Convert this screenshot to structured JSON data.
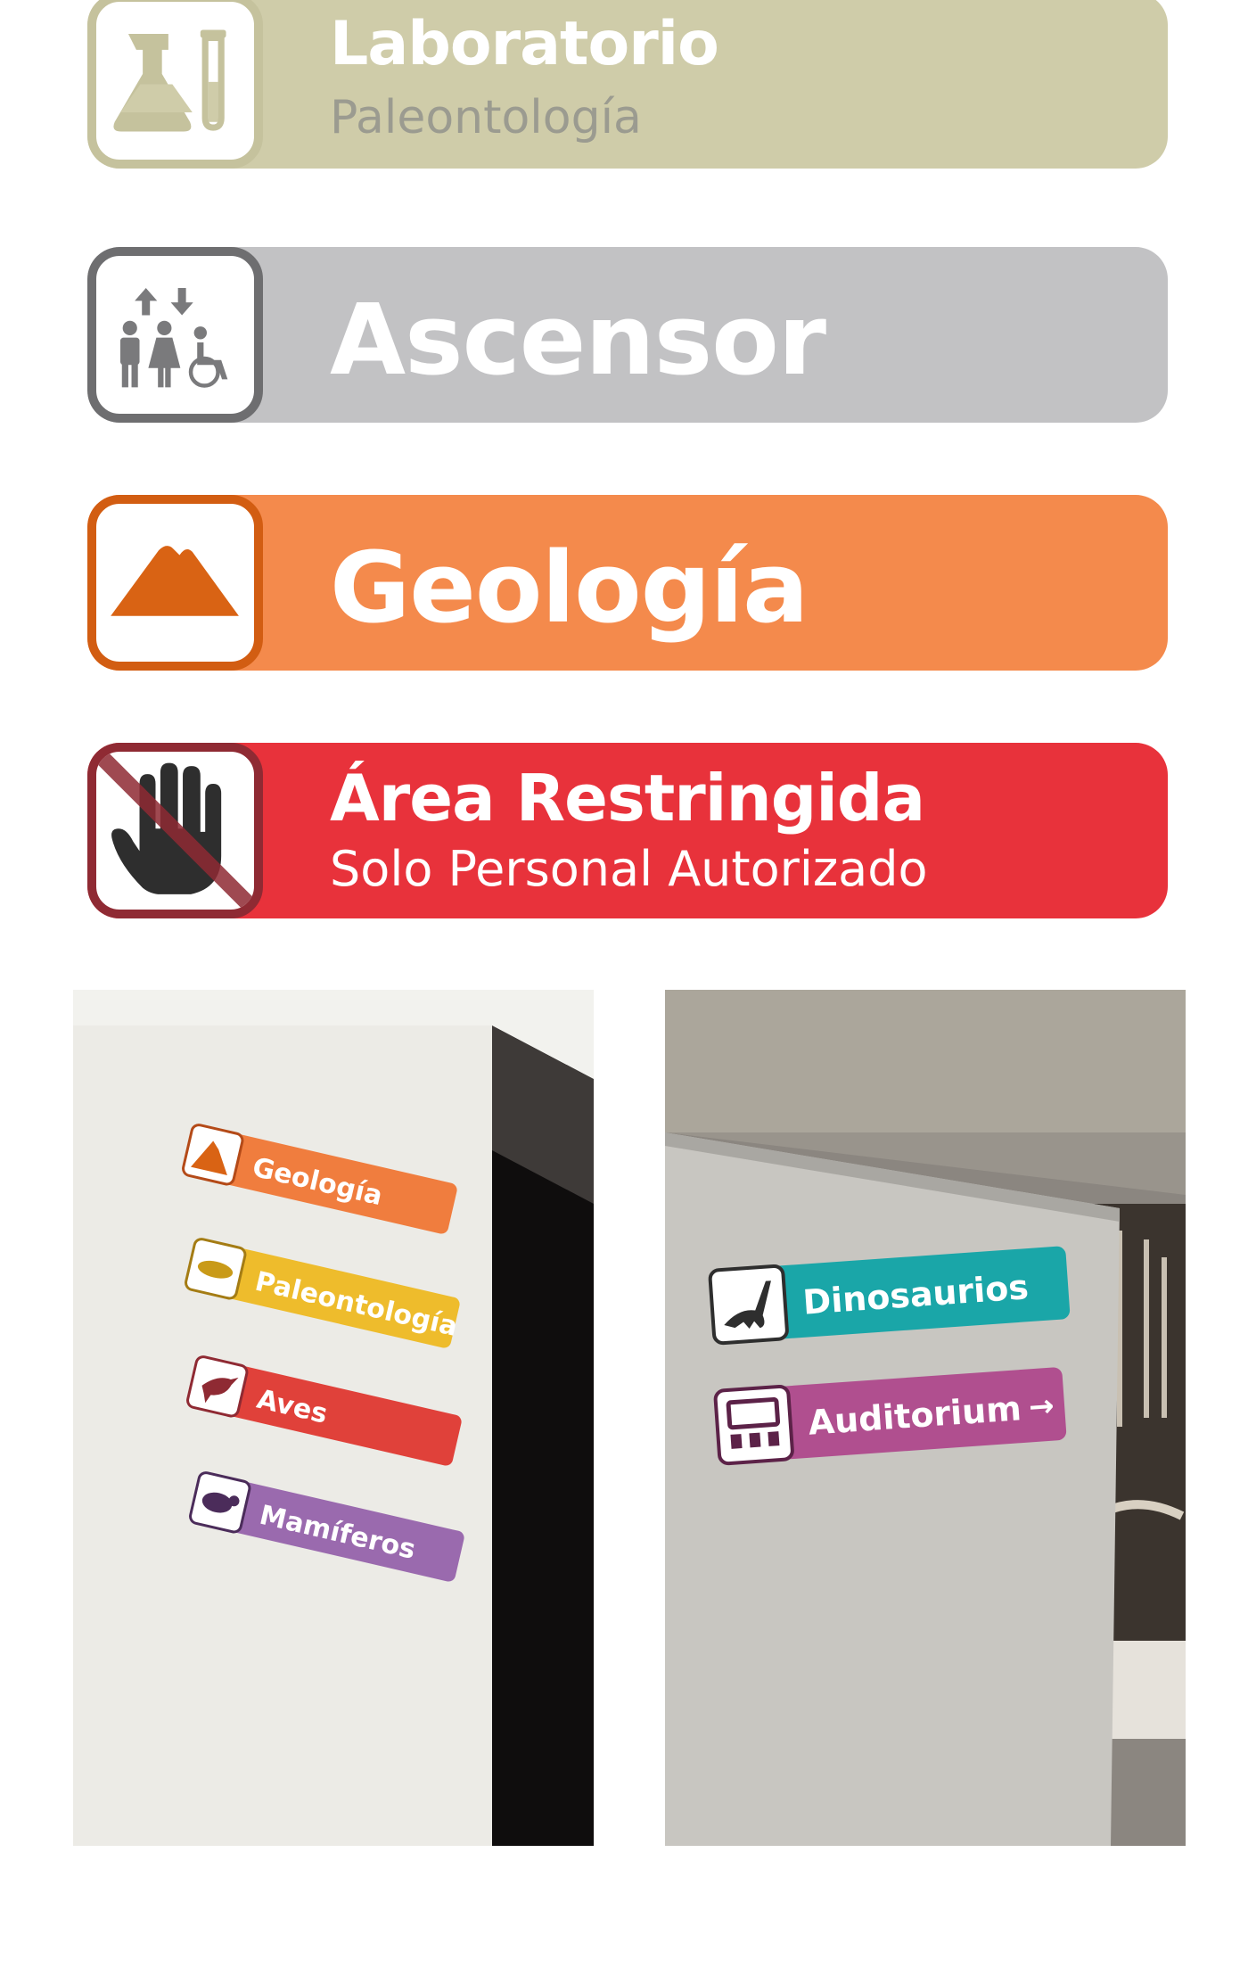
{
  "signs": [
    {
      "title": "Laboratorio",
      "subtitle": "Paleontología",
      "icon": "lab-flask-icon",
      "color": "#cfcca9"
    },
    {
      "title": "Ascensor",
      "icon": "elevator-icon",
      "color": "#c2c2c4"
    },
    {
      "title": "Geología",
      "icon": "volcano-icon",
      "color": "#f48a4c"
    },
    {
      "title": "Área Restringida",
      "subtitle": "Solo Personal Autorizado",
      "icon": "no-entry-hand-icon",
      "color": "#e8323b"
    }
  ],
  "photos": {
    "left": {
      "signs": [
        {
          "label": "Geología",
          "icon": "volcano-icon",
          "color": "#f07d3e"
        },
        {
          "label": "Paleontología",
          "icon": "fossil-animal-icon",
          "color": "#eebc2c"
        },
        {
          "label": "Aves",
          "icon": "bird-icon",
          "color": "#e0413a"
        },
        {
          "label": "Mamíferos",
          "icon": "capybara-icon",
          "color": "#9a6aae"
        }
      ]
    },
    "right": {
      "signs": [
        {
          "label": "Dinosaurios",
          "icon": "dinosaur-icon",
          "color": "#1aa6a8"
        },
        {
          "label": "Auditorium",
          "arrow": "→",
          "icon": "auditorium-icon",
          "color": "#b04f8f"
        }
      ]
    }
  }
}
